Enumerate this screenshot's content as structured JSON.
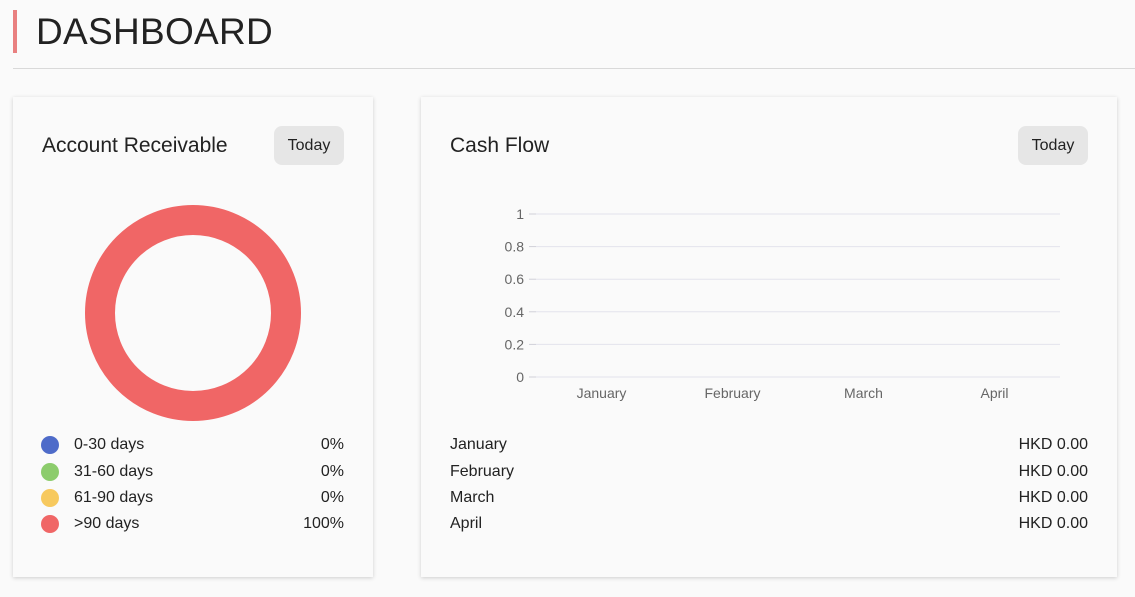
{
  "page": {
    "title": "DASHBOARD"
  },
  "colors": {
    "accent": "#e98080",
    "bucket_0_30": "#4e6bc9",
    "bucket_31_60": "#8ccc6c",
    "bucket_61_90": "#f7c95e",
    "bucket_90_plus": "#f06666"
  },
  "account_receivable": {
    "title": "Account Receivable",
    "period_button": "Today",
    "legend": [
      {
        "label": "0-30 days",
        "percent": "0%",
        "color": "#4e6bc9"
      },
      {
        "label": "31-60 days",
        "percent": "0%",
        "color": "#8ccc6c"
      },
      {
        "label": "61-90 days",
        "percent": "0%",
        "color": "#f7c95e"
      },
      {
        "label": ">90 days",
        "percent": "100%",
        "color": "#f06666"
      }
    ]
  },
  "cash_flow": {
    "title": "Cash Flow",
    "period_button": "Today",
    "rows": [
      {
        "month": "January",
        "amount": "HKD 0.00"
      },
      {
        "month": "February",
        "amount": "HKD 0.00"
      },
      {
        "month": "March",
        "amount": "HKD 0.00"
      },
      {
        "month": "April",
        "amount": "HKD 0.00"
      }
    ]
  },
  "chart_data": [
    {
      "type": "pie",
      "categories": [
        "0-30 days",
        "31-60 days",
        "61-90 days",
        ">90 days"
      ],
      "values": [
        0,
        0,
        0,
        100
      ],
      "colors": [
        "#4e6bc9",
        "#8ccc6c",
        "#f7c95e",
        "#f06666"
      ],
      "donut": true
    },
    {
      "type": "line",
      "categories": [
        "January",
        "February",
        "March",
        "April"
      ],
      "series": [
        {
          "values": [
            0,
            0,
            0,
            0
          ]
        }
      ],
      "yticks": [
        "0",
        "0.2",
        "0.4",
        "0.6",
        "0.8",
        "1"
      ],
      "ylim": [
        0,
        1
      ],
      "grid": true
    }
  ]
}
